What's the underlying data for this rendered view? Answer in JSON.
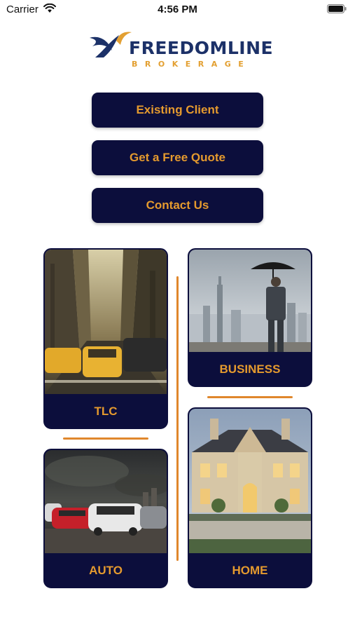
{
  "status_bar": {
    "carrier": "Carrier",
    "time": "4:56 PM"
  },
  "logo": {
    "name": "FREEDOMLINE",
    "subtitle": "BROKERAGE"
  },
  "menu": {
    "existing_client": "Existing Client",
    "free_quote": "Get a Free Quote",
    "contact_us": "Contact Us"
  },
  "cards": {
    "tlc": "TLC",
    "business": "BUSINESS",
    "auto": "AUTO",
    "home": "HOME"
  },
  "colors": {
    "navy": "#0c0e3c",
    "accent": "#e59a2e",
    "logo_blue": "#1c3168"
  }
}
